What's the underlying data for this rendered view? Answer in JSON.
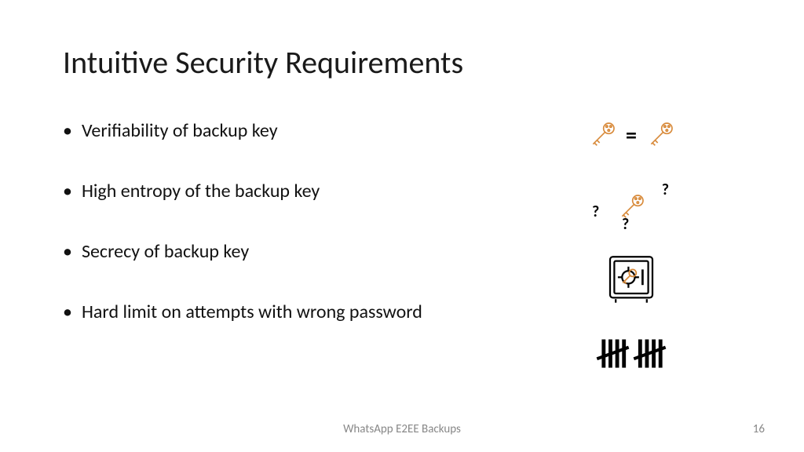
{
  "title": "Intuitive Security Requirements",
  "bullets": [
    "Verifiability of backup key",
    "High entropy of the backup key",
    "Secrecy of backup key",
    "Hard limit on attempts with wrong password"
  ],
  "equals_symbol": "=",
  "question_marks": {
    "q1": "?",
    "q2": "?",
    "q3": "?"
  },
  "footer": "WhatsApp E2EE Backups",
  "page_number": "16",
  "colors": {
    "key_stroke": "#d88a3a"
  }
}
